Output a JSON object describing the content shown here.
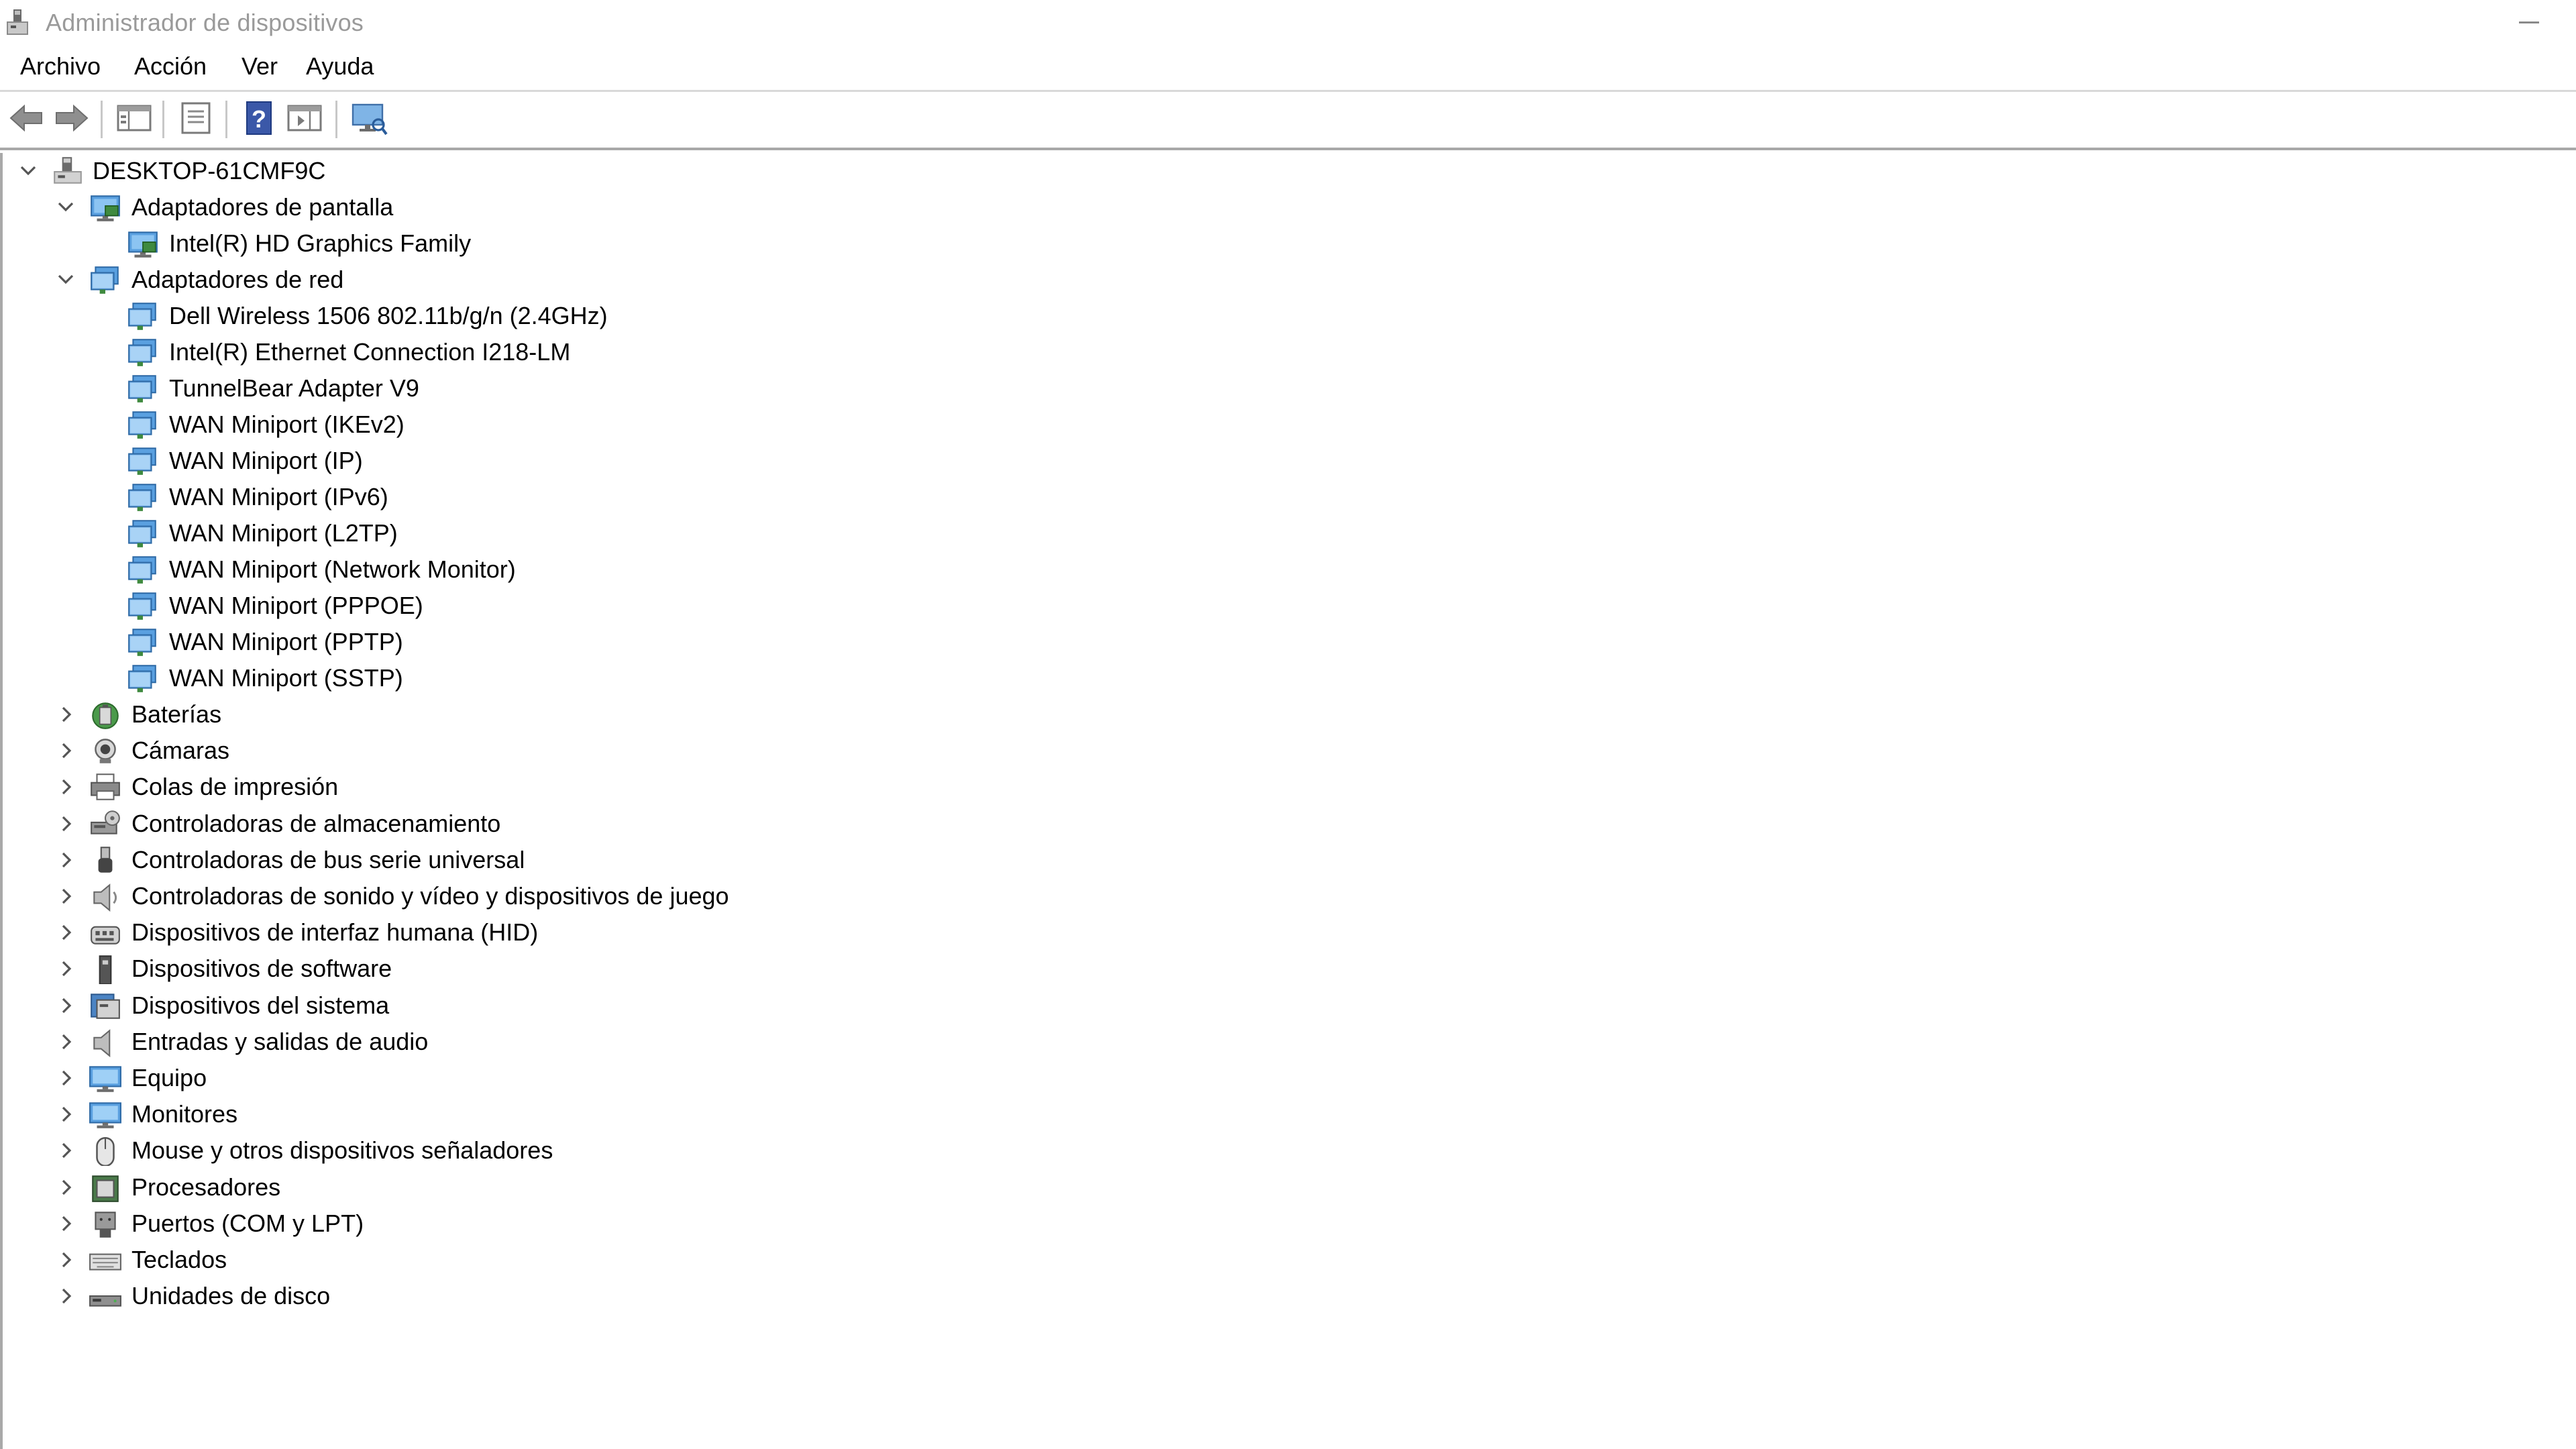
{
  "window": {
    "title": "Administrador de dispositivos"
  },
  "menu": {
    "archivo": "Archivo",
    "accion": "Acción",
    "ver": "Ver",
    "ayuda": "Ayuda"
  },
  "toolbar": [
    "back-arrow-icon",
    "forward-arrow-icon",
    "console-tree-icon",
    "properties-icon",
    "help-icon",
    "action-pane-icon",
    "scan-hardware-icon"
  ],
  "tree": {
    "root": "DESKTOP-61CMF9C",
    "display": {
      "label": "Adaptadores de pantalla",
      "children": [
        "Intel(R) HD Graphics Family"
      ]
    },
    "network": {
      "label": "Adaptadores de red",
      "children": [
        "Dell Wireless 1506 802.11b/g/n (2.4GHz)",
        "Intel(R) Ethernet Connection I218-LM",
        "TunnelBear Adapter V9",
        "WAN Miniport (IKEv2)",
        "WAN Miniport (IP)",
        "WAN Miniport (IPv6)",
        "WAN Miniport (L2TP)",
        "WAN Miniport (Network Monitor)",
        "WAN Miniport (PPPOE)",
        "WAN Miniport (PPTP)",
        "WAN Miniport (SSTP)"
      ]
    },
    "categories": [
      {
        "label": "Baterías",
        "icon": "battery-icon"
      },
      {
        "label": "Cámaras",
        "icon": "camera-icon"
      },
      {
        "label": "Colas de impresión",
        "icon": "printer-icon"
      },
      {
        "label": "Controladoras de almacenamiento",
        "icon": "storage-controller-icon"
      },
      {
        "label": "Controladoras de bus serie universal",
        "icon": "usb-icon"
      },
      {
        "label": "Controladoras de sonido y vídeo y dispositivos de juego",
        "icon": "speaker-icon"
      },
      {
        "label": "Dispositivos de interfaz humana (HID)",
        "icon": "hid-icon"
      },
      {
        "label": "Dispositivos de software",
        "icon": "software-device-icon"
      },
      {
        "label": "Dispositivos del sistema",
        "icon": "system-device-icon"
      },
      {
        "label": "Entradas y salidas de audio",
        "icon": "audio-icon"
      },
      {
        "label": "Equipo",
        "icon": "computer-icon"
      },
      {
        "label": "Monitores",
        "icon": "monitor-icon"
      },
      {
        "label": "Mouse y otros dispositivos señaladores",
        "icon": "mouse-icon"
      },
      {
        "label": "Procesadores",
        "icon": "processor-icon"
      },
      {
        "label": "Puertos (COM y LPT)",
        "icon": "port-icon"
      },
      {
        "label": "Teclados",
        "icon": "keyboard-icon"
      },
      {
        "label": "Unidades de disco",
        "icon": "disk-drive-icon"
      }
    ]
  }
}
